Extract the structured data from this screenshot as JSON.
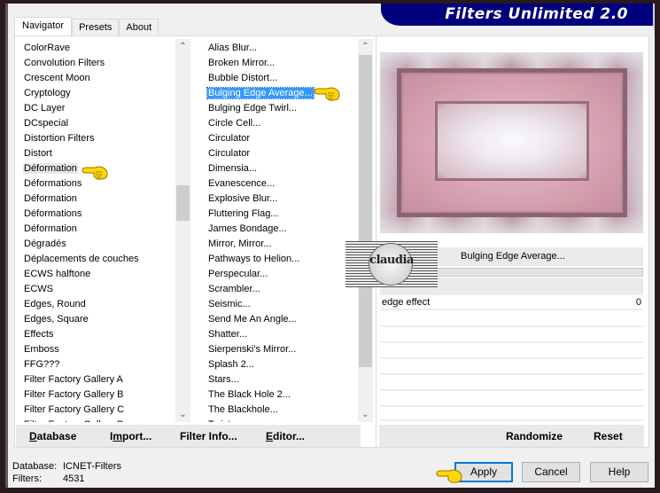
{
  "window": {
    "title": "Filters Unlimited 2.0"
  },
  "tabs": [
    {
      "label": "Navigator",
      "active": true
    },
    {
      "label": "Presets",
      "active": false
    },
    {
      "label": "About",
      "active": false
    }
  ],
  "categories": {
    "items": [
      "ColorRave",
      "Convolution Filters",
      "Crescent Moon",
      "Cryptology",
      "DC Layer",
      "DCspecial",
      "Distortion Filters",
      "Distort",
      "Déformation",
      "Déformations",
      "Déformation",
      "Déformations",
      "Déformation",
      "Dégradés",
      "Déplacements de couches",
      "ECWS halftone",
      "ECWS",
      "Edges, Round",
      "Edges, Square",
      "Effects",
      "Emboss",
      "FFG???",
      "Filter Factory Gallery A",
      "Filter Factory Gallery B",
      "Filter Factory Gallery C",
      "Filter Factory Gallery D"
    ],
    "selected_index": 8
  },
  "filters": {
    "items": [
      "Alias Blur...",
      "Broken Mirror...",
      "Bubble Distort...",
      "Bulging Edge Average...",
      "Bulging Edge Twirl...",
      "Circle Cell...",
      "Circulator",
      "Circulator",
      "Dimensia...",
      "Evanescence...",
      "Explosive Blur...",
      "Fluttering Flag...",
      "James Bondage...",
      "Mirror, Mirror...",
      "Pathways to Helion...",
      "Perspecular...",
      "Scrambler...",
      "Seismic...",
      "Send Me An Angle...",
      "Shatter...",
      "Sierpenski's Mirror...",
      "Splash 2...",
      "Stars...",
      "The Black Hole 2...",
      "The Blackhole...",
      "Twister..."
    ],
    "selected_index": 3
  },
  "filter_panel": {
    "selected_filter": "Bulging Edge Average...",
    "parameters": [
      {
        "name": "edge effect",
        "value": "0"
      }
    ]
  },
  "left_buttons": {
    "database": "Database",
    "import": "Import...",
    "filter_info": "Filter Info...",
    "editor": "Editor..."
  },
  "right_buttons": {
    "randomize": "Randomize",
    "reset": "Reset"
  },
  "status": {
    "database_label": "Database:",
    "database_value": "ICNET-Filters",
    "filters_label": "Filters:",
    "filters_value": "4531"
  },
  "dialog_buttons": {
    "apply": "Apply",
    "cancel": "Cancel",
    "help": "Help"
  },
  "watermark": {
    "text": "claudia"
  },
  "icons": {
    "pointer": "pointing-hand-icon",
    "scroll_up": "chevron-up-icon",
    "scroll_down": "chevron-down-icon"
  }
}
